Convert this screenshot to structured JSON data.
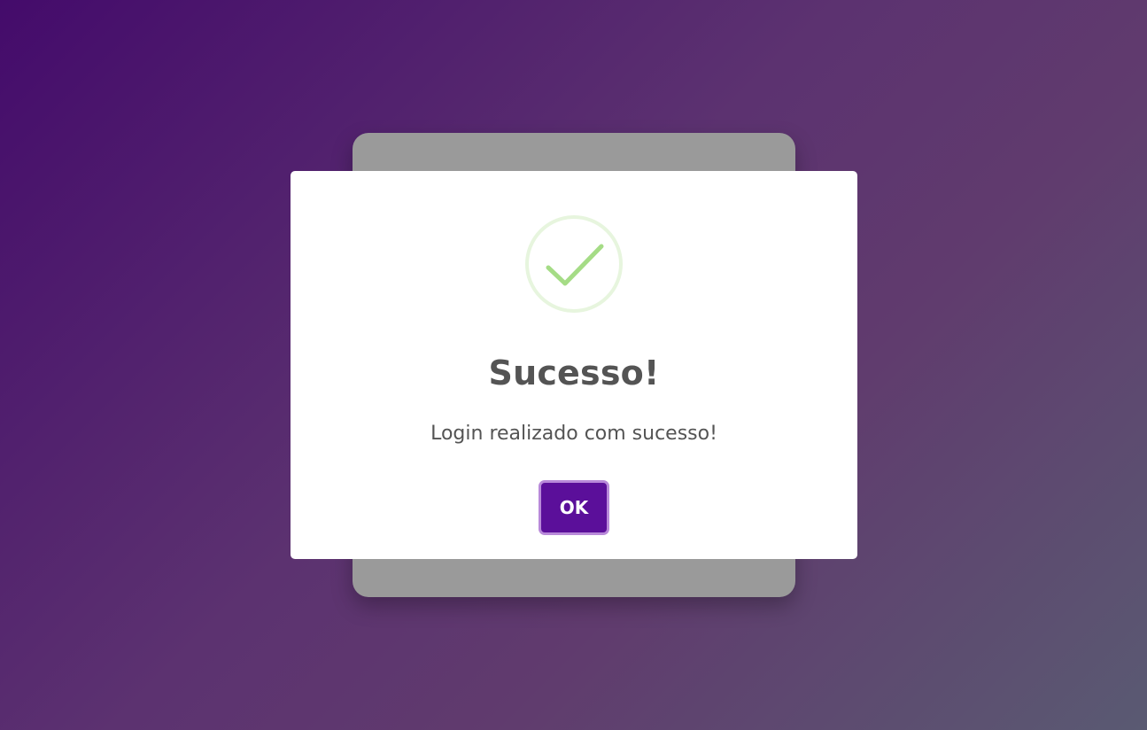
{
  "dialog": {
    "title": "Sucesso!",
    "message": "Login realizado com sucesso!",
    "ok_label": "OK",
    "icon": "check-circle-icon"
  },
  "colors": {
    "accent": "#5b0f9a",
    "success": "#a5dc86",
    "text": "#545454"
  }
}
